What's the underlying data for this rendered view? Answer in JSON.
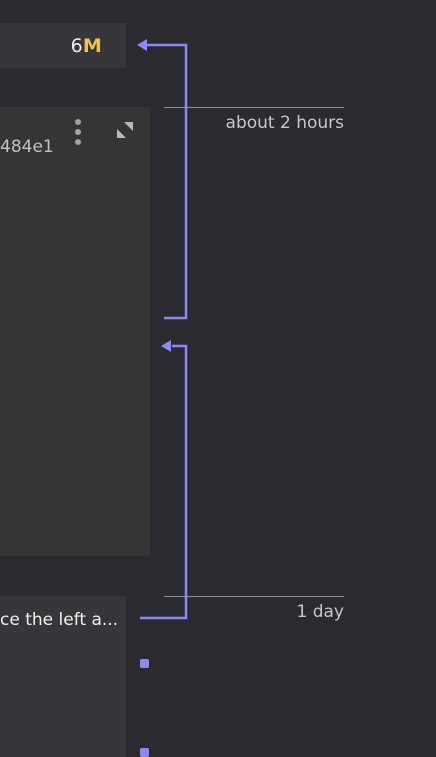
{
  "counter": {
    "value": "6",
    "suffix": "M"
  },
  "node_card": {
    "id_fragment": "484e1",
    "menu_icon": "kebab-menu-icon",
    "expand_icon": "expand-icon"
  },
  "bottom_card": {
    "text": "ce the left a..."
  },
  "timeline": {
    "labels": [
      "about 2 hours",
      "1 day"
    ]
  },
  "colors": {
    "background": "#2b2a30",
    "card": "#37363b",
    "accent": "#8c8cf0",
    "highlight": "#f2c14e"
  }
}
